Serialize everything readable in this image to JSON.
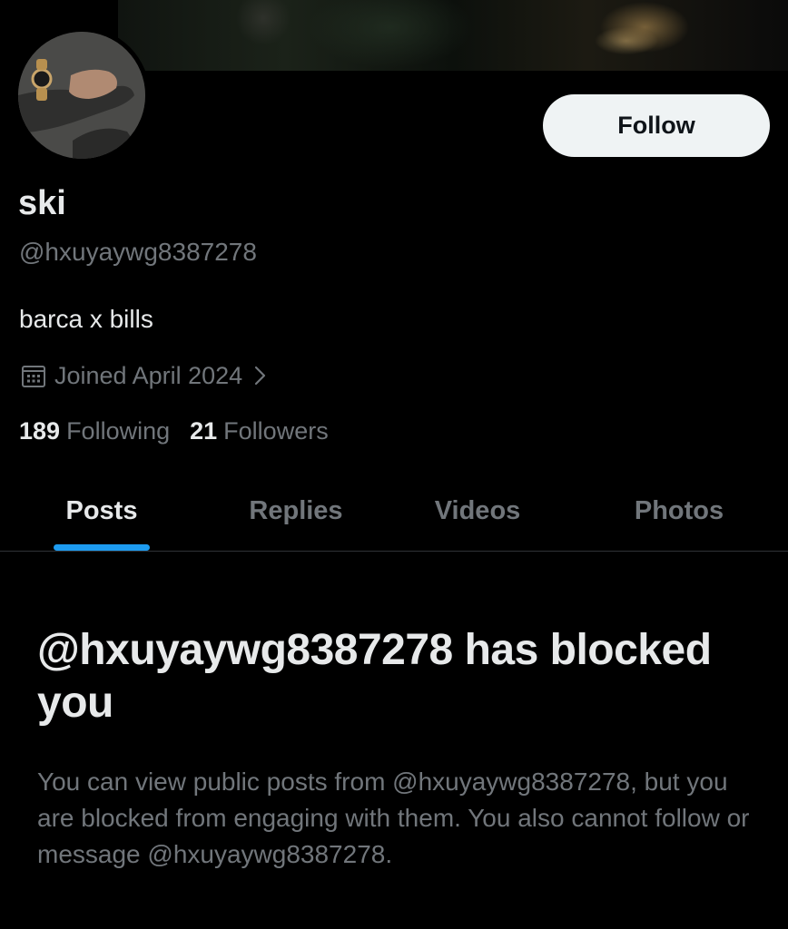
{
  "profile": {
    "display_name": "ski",
    "handle": "@hxuyaywg8387278",
    "bio": "barca x bills",
    "joined": "Joined April 2024",
    "following_count": "189",
    "following_label": "Following",
    "followers_count": "21",
    "followers_label": "Followers"
  },
  "actions": {
    "follow_label": "Follow"
  },
  "tabs": [
    {
      "label": "Posts",
      "active": true
    },
    {
      "label": "Replies",
      "active": false
    },
    {
      "label": "Videos",
      "active": false
    },
    {
      "label": "Photos",
      "active": false
    }
  ],
  "blocked": {
    "title": "@hxuyaywg8387278 has blocked you",
    "message": "You can view public posts from @hxuyaywg8387278, but you are blocked from engaging with them. You also cannot follow or message @hxuyaywg8387278."
  },
  "icons": {
    "calendar": "calendar-icon",
    "chevron": "chevron-right-icon"
  },
  "colors": {
    "background": "#000000",
    "primary_text": "#e7e9ea",
    "secondary_text": "#71767b",
    "accent": "#1d9bf0",
    "button_bg": "#eff3f4"
  }
}
